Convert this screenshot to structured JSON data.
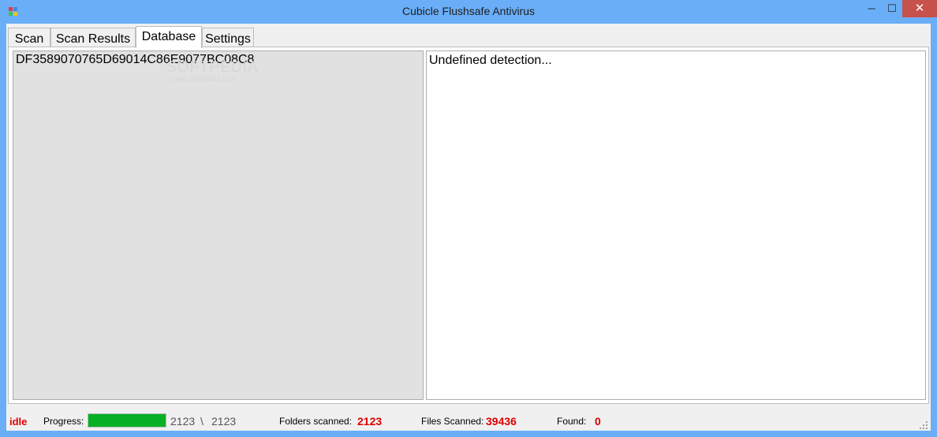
{
  "window": {
    "title": "Cubicle Flushsafe Antivirus",
    "controls": {
      "minimize": "─",
      "maximize": "☐",
      "close": "✕"
    }
  },
  "tabs": [
    {
      "label": "Scan"
    },
    {
      "label": "Scan Results"
    },
    {
      "label": "Database",
      "active": true
    },
    {
      "label": "Settings"
    }
  ],
  "database": {
    "signatures": [
      "DF3589070765D69014C86E9077BC08C8"
    ],
    "watermark": "SOFTPEDIA",
    "watermark_url": "www.softpedia.com",
    "detail_text": "Undefined detection..."
  },
  "status": {
    "state": "idle",
    "progress_label": "Progress:",
    "progress_fraction": 1.0,
    "progress_current": "2123",
    "progress_sep": "\\",
    "progress_total": "2123",
    "folders_label": "Folders scanned:",
    "folders_value": "2123",
    "files_label": "Files Scanned:",
    "files_value": "39436",
    "found_label": "Found:",
    "found_value": "0"
  },
  "colors": {
    "titlebar": "#6aaef7",
    "accent_red": "#e00000",
    "progress_green": "#06b025",
    "close_button": "#c7514b"
  }
}
